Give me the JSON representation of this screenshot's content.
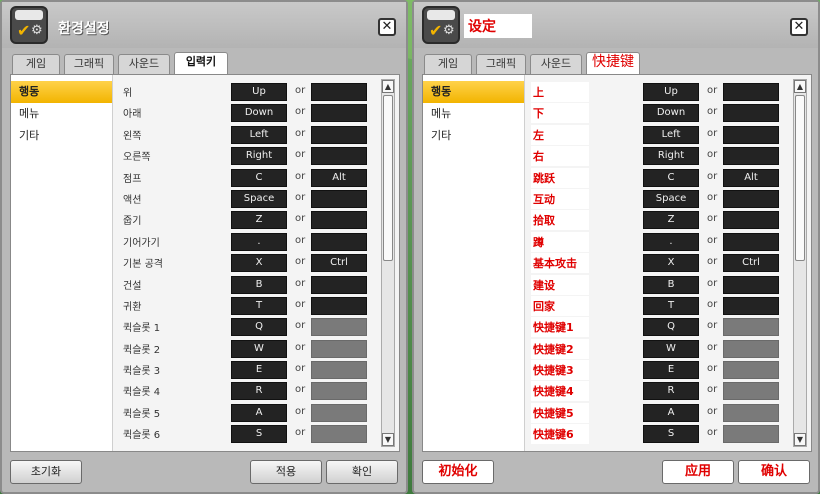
{
  "left": {
    "title": "환경설정",
    "tabs": [
      "게임",
      "그래픽",
      "사운드",
      "입력키"
    ],
    "categories": [
      "행동",
      "메뉴",
      "기타"
    ],
    "rows": [
      {
        "label": "위",
        "key1": "Up",
        "or": "or",
        "key2": ""
      },
      {
        "label": "아래",
        "key1": "Down",
        "or": "or",
        "key2": ""
      },
      {
        "label": "왼쪽",
        "key1": "Left",
        "or": "or",
        "key2": ""
      },
      {
        "label": "오른쪽",
        "key1": "Right",
        "or": "or",
        "key2": ""
      },
      {
        "label": "점프",
        "key1": "C",
        "or": "or",
        "key2": "Alt"
      },
      {
        "label": "액션",
        "key1": "Space",
        "or": "or",
        "key2": ""
      },
      {
        "label": "줍기",
        "key1": "Z",
        "or": "or",
        "key2": ""
      },
      {
        "label": "기어가기",
        "key1": ".",
        "or": "or",
        "key2": ""
      },
      {
        "label": "기본 공격",
        "key1": "X",
        "or": "or",
        "key2": "Ctrl"
      },
      {
        "label": "건설",
        "key1": "B",
        "or": "or",
        "key2": ""
      },
      {
        "label": "귀환",
        "key1": "T",
        "or": "or",
        "key2": ""
      },
      {
        "label": "퀵슬롯 1",
        "key1": "Q",
        "or": "or",
        "key2": ""
      },
      {
        "label": "퀵슬롯 2",
        "key1": "W",
        "or": "or",
        "key2": ""
      },
      {
        "label": "퀵슬롯 3",
        "key1": "E",
        "or": "or",
        "key2": ""
      },
      {
        "label": "퀵슬롯 4",
        "key1": "R",
        "or": "or",
        "key2": ""
      },
      {
        "label": "퀵슬롯 5",
        "key1": "A",
        "or": "or",
        "key2": ""
      },
      {
        "label": "퀵슬롯 6",
        "key1": "S",
        "or": "or",
        "key2": ""
      }
    ],
    "buttons": {
      "reset": "초기화",
      "apply": "적용",
      "confirm": "확인"
    }
  },
  "right": {
    "title": "设定",
    "tabs": [
      "게임",
      "그래픽",
      "사운드",
      "快捷键"
    ],
    "categories": [
      "행동",
      "메뉴",
      "기타"
    ],
    "rows": [
      {
        "label": "上",
        "key1": "Up",
        "or": "or",
        "key2": ""
      },
      {
        "label": "下",
        "key1": "Down",
        "or": "or",
        "key2": ""
      },
      {
        "label": "左",
        "key1": "Left",
        "or": "or",
        "key2": ""
      },
      {
        "label": "右",
        "key1": "Right",
        "or": "or",
        "key2": ""
      },
      {
        "label": "跳跃",
        "key1": "C",
        "or": "or",
        "key2": "Alt"
      },
      {
        "label": "互动",
        "key1": "Space",
        "or": "or",
        "key2": ""
      },
      {
        "label": "拾取",
        "key1": "Z",
        "or": "or",
        "key2": ""
      },
      {
        "label": "蹲",
        "key1": ".",
        "or": "or",
        "key2": ""
      },
      {
        "label": "基本攻击",
        "key1": "X",
        "or": "or",
        "key2": "Ctrl"
      },
      {
        "label": "建设",
        "key1": "B",
        "or": "or",
        "key2": ""
      },
      {
        "label": "回家",
        "key1": "T",
        "or": "or",
        "key2": ""
      },
      {
        "label": "快捷键1",
        "key1": "Q",
        "or": "or",
        "key2": ""
      },
      {
        "label": "快捷键2",
        "key1": "W",
        "or": "or",
        "key2": ""
      },
      {
        "label": "快捷键3",
        "key1": "E",
        "or": "or",
        "key2": ""
      },
      {
        "label": "快捷键4",
        "key1": "R",
        "or": "or",
        "key2": ""
      },
      {
        "label": "快捷键5",
        "key1": "A",
        "or": "or",
        "key2": ""
      },
      {
        "label": "快捷键6",
        "key1": "S",
        "or": "or",
        "key2": ""
      }
    ],
    "buttons": {
      "reset": "初始化",
      "apply": "应用",
      "confirm": "确认"
    }
  },
  "colors": {
    "selected_category": "#f2b400",
    "key_bg": "#232323",
    "overlay_text": "#e00000"
  }
}
